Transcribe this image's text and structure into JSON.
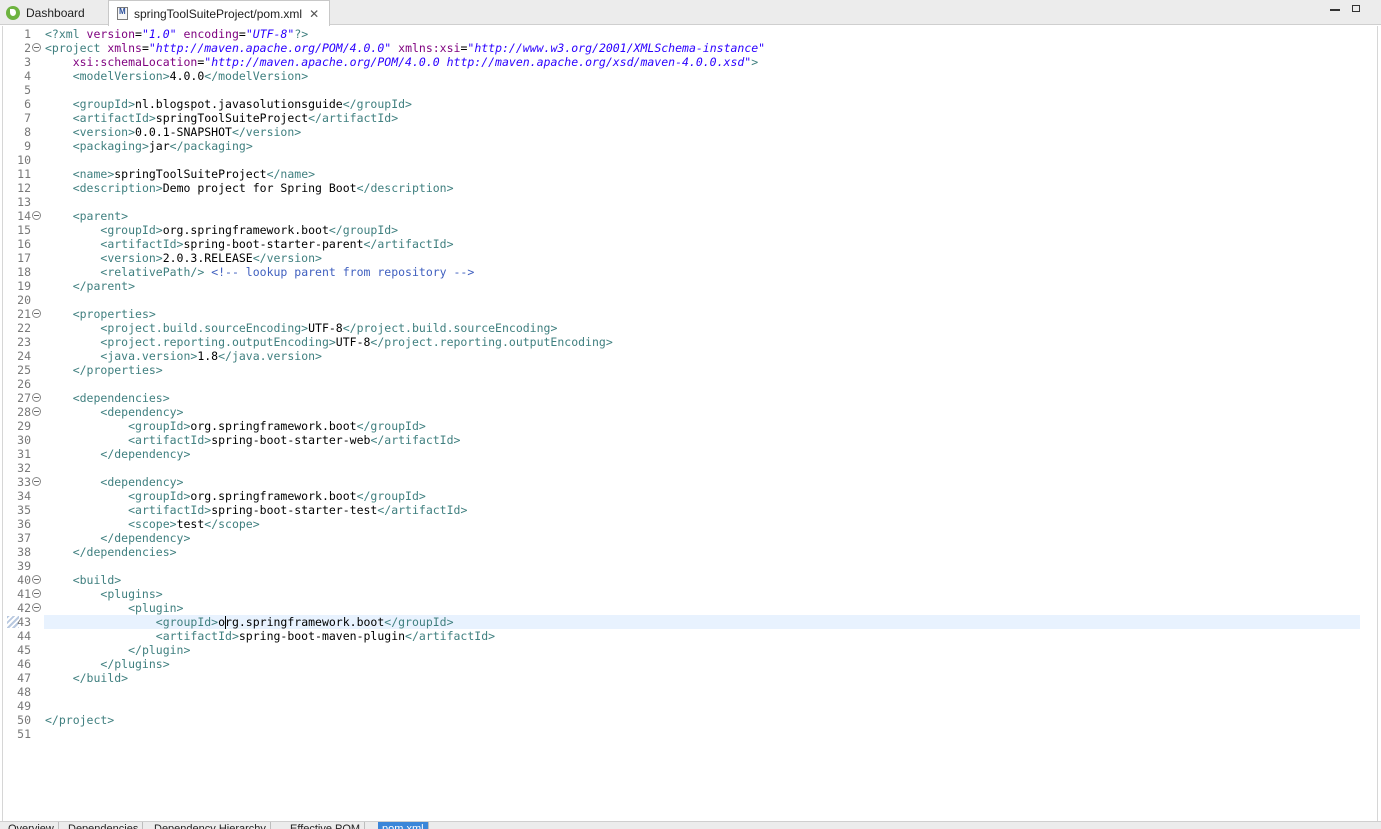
{
  "tabs": [
    {
      "label": "Dashboard",
      "icon": "spring-icon"
    },
    {
      "label": "springToolSuiteProject/pom.xml",
      "icon": "maven-file-icon",
      "active": true
    }
  ],
  "editor": {
    "current_line": 43,
    "lines": [
      {
        "n": "1",
        "segs": [
          [
            "pi",
            "<?xml "
          ],
          [
            "at",
            "version"
          ],
          [
            "",
            ""
          ],
          [
            "",
            "="
          ],
          [
            "av",
            "\"1.0\""
          ],
          [
            "",
            " "
          ],
          [
            "at",
            "encoding"
          ],
          [
            "",
            "="
          ],
          [
            "av",
            "\"UTF-8\""
          ],
          [
            "pi",
            "?>"
          ]
        ]
      },
      {
        "n": "2",
        "fold": true,
        "segs": [
          [
            "tg",
            "<project "
          ],
          [
            "at",
            "xmlns"
          ],
          [
            "",
            "="
          ],
          [
            "av",
            "\"http://maven.apache.org/POM/4.0.0\""
          ],
          [
            "",
            " "
          ],
          [
            "at",
            "xmlns:xsi"
          ],
          [
            "",
            "="
          ],
          [
            "av",
            "\"http://www.w3.org/2001/XMLSchema-instance\""
          ]
        ]
      },
      {
        "n": "3",
        "segs": [
          [
            "",
            "    "
          ],
          [
            "at",
            "xsi:schemaLocation"
          ],
          [
            "",
            "="
          ],
          [
            "av",
            "\"http://maven.apache.org/POM/4.0.0 http://maven.apache.org/xsd/maven-4.0.0.xsd\""
          ],
          [
            "tg",
            ">"
          ]
        ]
      },
      {
        "n": "4",
        "segs": [
          [
            "",
            "    "
          ],
          [
            "tg",
            "<modelVersion>"
          ],
          [
            "",
            "4.0.0"
          ],
          [
            "tg",
            "</modelVersion>"
          ]
        ]
      },
      {
        "n": "5",
        "segs": []
      },
      {
        "n": "6",
        "segs": [
          [
            "",
            "    "
          ],
          [
            "tg",
            "<groupId>"
          ],
          [
            "",
            "nl.blogspot.javasolutionsguide"
          ],
          [
            "tg",
            "</groupId>"
          ]
        ]
      },
      {
        "n": "7",
        "segs": [
          [
            "",
            "    "
          ],
          [
            "tg",
            "<artifactId>"
          ],
          [
            "",
            "springToolSuiteProject"
          ],
          [
            "tg",
            "</artifactId>"
          ]
        ]
      },
      {
        "n": "8",
        "segs": [
          [
            "",
            "    "
          ],
          [
            "tg",
            "<version>"
          ],
          [
            "",
            "0.0.1-SNAPSHOT"
          ],
          [
            "tg",
            "</version>"
          ]
        ]
      },
      {
        "n": "9",
        "segs": [
          [
            "",
            "    "
          ],
          [
            "tg",
            "<packaging>"
          ],
          [
            "",
            "jar"
          ],
          [
            "tg",
            "</packaging>"
          ]
        ]
      },
      {
        "n": "10",
        "segs": []
      },
      {
        "n": "11",
        "segs": [
          [
            "",
            "    "
          ],
          [
            "tg",
            "<name>"
          ],
          [
            "",
            "springToolSuiteProject"
          ],
          [
            "tg",
            "</name>"
          ]
        ]
      },
      {
        "n": "12",
        "segs": [
          [
            "",
            "    "
          ],
          [
            "tg",
            "<description>"
          ],
          [
            "",
            "Demo project for Spring Boot"
          ],
          [
            "tg",
            "</description>"
          ]
        ]
      },
      {
        "n": "13",
        "segs": []
      },
      {
        "n": "14",
        "fold": true,
        "segs": [
          [
            "",
            "    "
          ],
          [
            "tg",
            "<parent>"
          ]
        ]
      },
      {
        "n": "15",
        "segs": [
          [
            "",
            "        "
          ],
          [
            "tg",
            "<groupId>"
          ],
          [
            "",
            "org.springframework.boot"
          ],
          [
            "tg",
            "</groupId>"
          ]
        ]
      },
      {
        "n": "16",
        "segs": [
          [
            "",
            "        "
          ],
          [
            "tg",
            "<artifactId>"
          ],
          [
            "",
            "spring-boot-starter-parent"
          ],
          [
            "tg",
            "</artifactId>"
          ]
        ]
      },
      {
        "n": "17",
        "segs": [
          [
            "",
            "        "
          ],
          [
            "tg",
            "<version>"
          ],
          [
            "",
            "2.0.3.RELEASE"
          ],
          [
            "tg",
            "</version>"
          ]
        ]
      },
      {
        "n": "18",
        "segs": [
          [
            "",
            "        "
          ],
          [
            "tg",
            "<relativePath/>"
          ],
          [
            "",
            " "
          ],
          [
            "cm",
            "<!-- lookup parent from repository -->"
          ]
        ]
      },
      {
        "n": "19",
        "segs": [
          [
            "",
            "    "
          ],
          [
            "tg",
            "</parent>"
          ]
        ]
      },
      {
        "n": "20",
        "segs": []
      },
      {
        "n": "21",
        "fold": true,
        "segs": [
          [
            "",
            "    "
          ],
          [
            "tg",
            "<properties>"
          ]
        ]
      },
      {
        "n": "22",
        "segs": [
          [
            "",
            "        "
          ],
          [
            "tg",
            "<project.build.sourceEncoding>"
          ],
          [
            "",
            "UTF-8"
          ],
          [
            "tg",
            "</project.build.sourceEncoding>"
          ]
        ]
      },
      {
        "n": "23",
        "segs": [
          [
            "",
            "        "
          ],
          [
            "tg",
            "<project.reporting.outputEncoding>"
          ],
          [
            "",
            "UTF-8"
          ],
          [
            "tg",
            "</project.reporting.outputEncoding>"
          ]
        ]
      },
      {
        "n": "24",
        "segs": [
          [
            "",
            "        "
          ],
          [
            "tg",
            "<java.version>"
          ],
          [
            "",
            "1.8"
          ],
          [
            "tg",
            "</java.version>"
          ]
        ]
      },
      {
        "n": "25",
        "segs": [
          [
            "",
            "    "
          ],
          [
            "tg",
            "</properties>"
          ]
        ]
      },
      {
        "n": "26",
        "segs": []
      },
      {
        "n": "27",
        "fold": true,
        "segs": [
          [
            "",
            "    "
          ],
          [
            "tg",
            "<dependencies>"
          ]
        ]
      },
      {
        "n": "28",
        "fold": true,
        "segs": [
          [
            "",
            "        "
          ],
          [
            "tg",
            "<dependency>"
          ]
        ]
      },
      {
        "n": "29",
        "segs": [
          [
            "",
            "            "
          ],
          [
            "tg",
            "<groupId>"
          ],
          [
            "",
            "org.springframework.boot"
          ],
          [
            "tg",
            "</groupId>"
          ]
        ]
      },
      {
        "n": "30",
        "segs": [
          [
            "",
            "            "
          ],
          [
            "tg",
            "<artifactId>"
          ],
          [
            "",
            "spring-boot-starter-web"
          ],
          [
            "tg",
            "</artifactId>"
          ]
        ]
      },
      {
        "n": "31",
        "segs": [
          [
            "",
            "        "
          ],
          [
            "tg",
            "</dependency>"
          ]
        ]
      },
      {
        "n": "32",
        "segs": []
      },
      {
        "n": "33",
        "fold": true,
        "segs": [
          [
            "",
            "        "
          ],
          [
            "tg",
            "<dependency>"
          ]
        ]
      },
      {
        "n": "34",
        "segs": [
          [
            "",
            "            "
          ],
          [
            "tg",
            "<groupId>"
          ],
          [
            "",
            "org.springframework.boot"
          ],
          [
            "tg",
            "</groupId>"
          ]
        ]
      },
      {
        "n": "35",
        "segs": [
          [
            "",
            "            "
          ],
          [
            "tg",
            "<artifactId>"
          ],
          [
            "",
            "spring-boot-starter-test"
          ],
          [
            "tg",
            "</artifactId>"
          ]
        ]
      },
      {
        "n": "36",
        "segs": [
          [
            "",
            "            "
          ],
          [
            "tg",
            "<scope>"
          ],
          [
            "",
            "test"
          ],
          [
            "tg",
            "</scope>"
          ]
        ]
      },
      {
        "n": "37",
        "segs": [
          [
            "",
            "        "
          ],
          [
            "tg",
            "</dependency>"
          ]
        ]
      },
      {
        "n": "38",
        "segs": [
          [
            "",
            "    "
          ],
          [
            "tg",
            "</dependencies>"
          ]
        ]
      },
      {
        "n": "39",
        "segs": []
      },
      {
        "n": "40",
        "fold": true,
        "segs": [
          [
            "",
            "    "
          ],
          [
            "tg",
            "<build>"
          ]
        ]
      },
      {
        "n": "41",
        "fold": true,
        "segs": [
          [
            "",
            "        "
          ],
          [
            "tg",
            "<plugins>"
          ]
        ]
      },
      {
        "n": "42",
        "fold": true,
        "segs": [
          [
            "",
            "            "
          ],
          [
            "tg",
            "<plugin>"
          ]
        ]
      },
      {
        "n": "43",
        "segs": [
          [
            "",
            "                "
          ],
          [
            "tg",
            "<groupId>"
          ],
          [
            "",
            "o"
          ],
          [
            "cursor",
            ""
          ],
          [
            "",
            "rg.springframework.boot"
          ],
          [
            "tg",
            "</groupId>"
          ]
        ]
      },
      {
        "n": "44",
        "segs": [
          [
            "",
            "                "
          ],
          [
            "tg",
            "<artifactId>"
          ],
          [
            "",
            "spring-boot-maven-plugin"
          ],
          [
            "tg",
            "</artifactId>"
          ]
        ]
      },
      {
        "n": "45",
        "segs": [
          [
            "",
            "            "
          ],
          [
            "tg",
            "</plugin>"
          ]
        ]
      },
      {
        "n": "46",
        "segs": [
          [
            "",
            "        "
          ],
          [
            "tg",
            "</plugins>"
          ]
        ]
      },
      {
        "n": "47",
        "segs": [
          [
            "",
            "    "
          ],
          [
            "tg",
            "</build>"
          ]
        ]
      },
      {
        "n": "48",
        "segs": []
      },
      {
        "n": "49",
        "segs": []
      },
      {
        "n": "50",
        "segs": [
          [
            "tg",
            "</project>"
          ]
        ]
      },
      {
        "n": "51",
        "segs": []
      }
    ]
  },
  "bottom_tabs": [
    "Overview",
    "Dependencies",
    "Dependency Hierarchy",
    "Effective POM",
    "pom.xml"
  ],
  "bottom_active": "pom.xml",
  "colors": {
    "tag": "#3f7f7f",
    "attribute": "#7f007f",
    "attribute_value": "#2a00ff",
    "comment": "#3f5fbf",
    "current_line": "#e8f2fe",
    "active_bottom_tab": "#3b86d9"
  }
}
